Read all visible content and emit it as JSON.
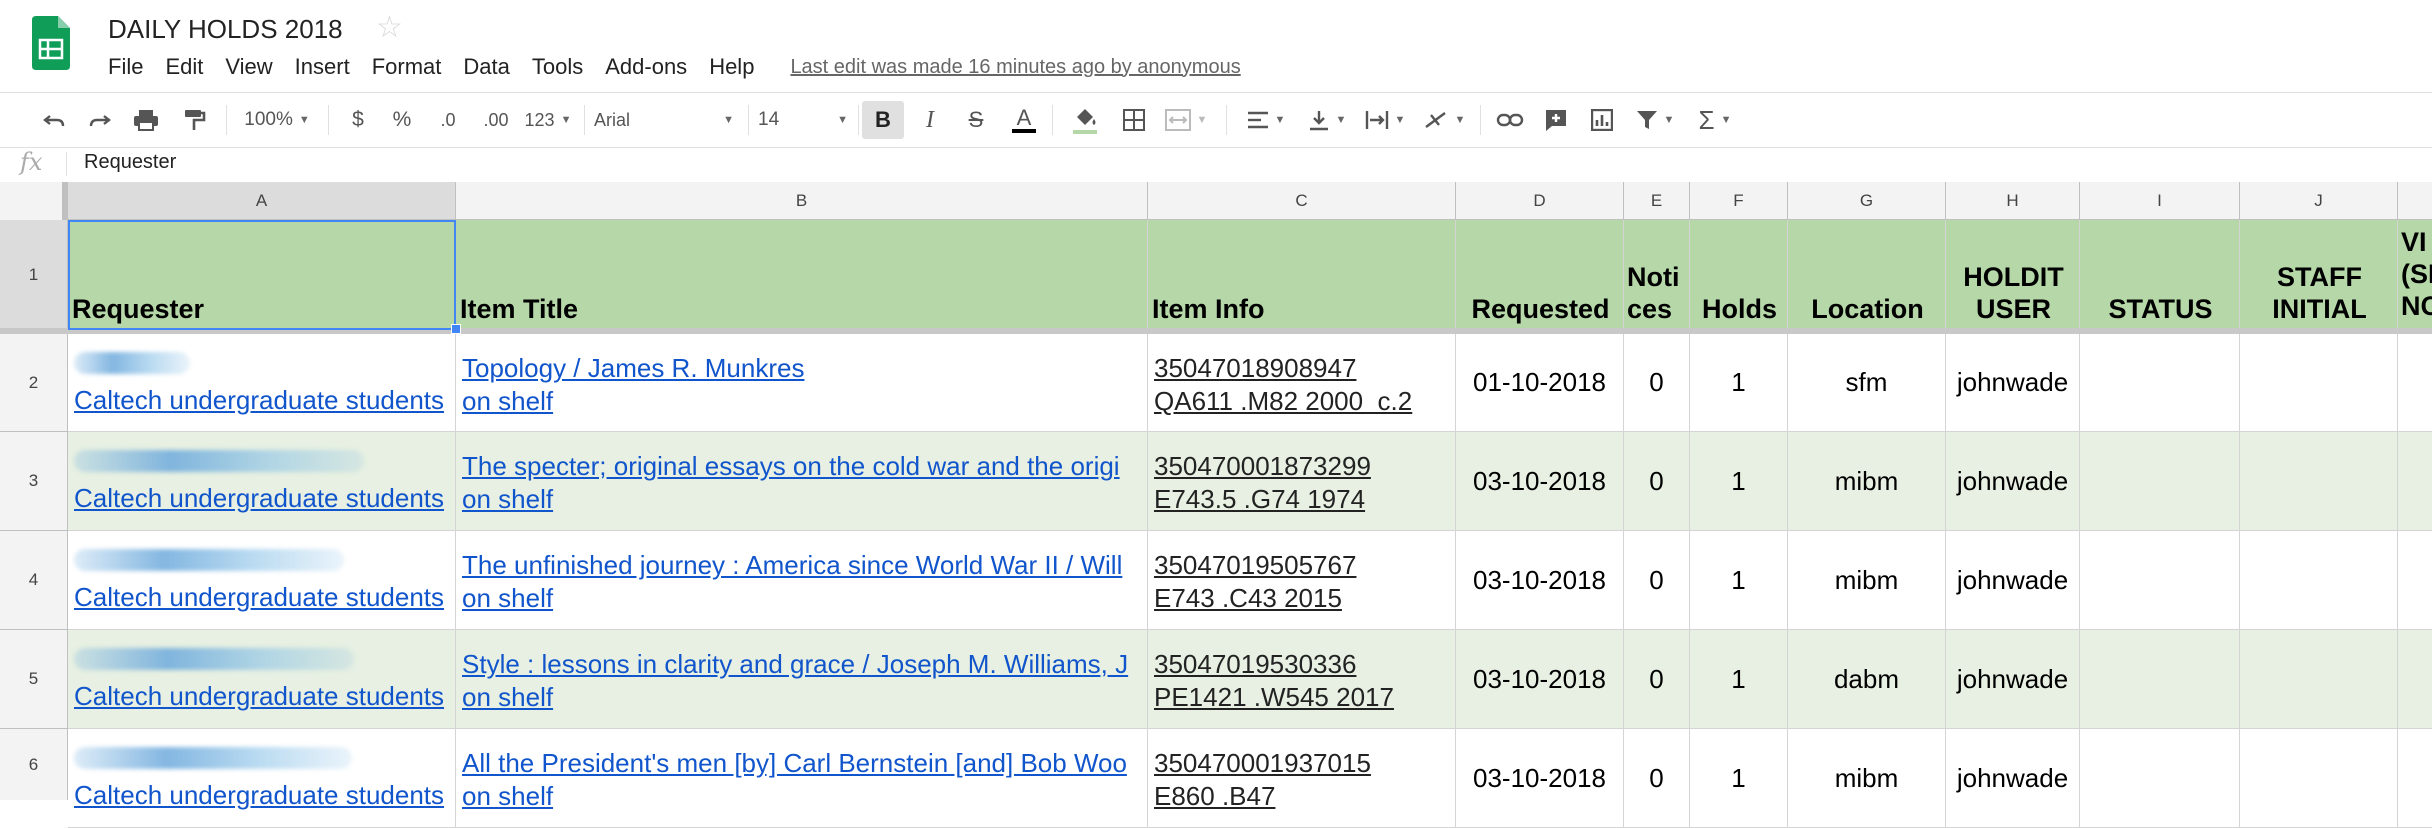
{
  "app": {
    "title": "DAILY HOLDS 2018",
    "last_edit": "Last edit was made 16 minutes ago by anonymous",
    "menus": [
      "File",
      "Edit",
      "View",
      "Insert",
      "Format",
      "Data",
      "Tools",
      "Add-ons",
      "Help"
    ]
  },
  "toolbar": {
    "zoom": "100%",
    "currency": "$",
    "percent": "%",
    "dec_less": ".0",
    "dec_more": ".00",
    "more_formats": "123",
    "font": "Arial",
    "font_size": "14",
    "bold": "B",
    "italic": "I",
    "strike": "S",
    "text_color": "A"
  },
  "formula_bar": {
    "fx": "fx",
    "value": "Requester"
  },
  "columns": [
    "A",
    "B",
    "C",
    "D",
    "E",
    "F",
    "G",
    "H",
    "I",
    "J"
  ],
  "row_numbers": [
    "1",
    "2",
    "3",
    "4",
    "5",
    "6"
  ],
  "headers": {
    "requester": "Requester",
    "item_title": "Item Title",
    "item_info": "Item Info",
    "requested": "Requested",
    "notices": "Noti ces",
    "holds": "Holds",
    "location": "Location",
    "holdit_user": "HOLDIT USER",
    "status": "STATUS",
    "staff_initial": "STAFF INITIAL",
    "overflow": "VI (SI NC"
  },
  "rows": [
    {
      "requester": "Caltech undergraduate students",
      "title": "Topology / James R. Munkres",
      "title_sub": "on shelf",
      "barcode": "35047018908947",
      "callno": "QA611 .M82 2000  c.2",
      "requested": "01-10-2018",
      "notices": "0",
      "holds": "1",
      "location": "sfm",
      "user": "johnwade"
    },
    {
      "requester": "Caltech undergraduate students",
      "title": "The specter; original essays on the cold war and the origi",
      "title_sub": "on shelf",
      "barcode": "350470001873299",
      "callno": "E743.5 .G74 1974",
      "requested": "03-10-2018",
      "notices": "0",
      "holds": "1",
      "location": "mibm",
      "user": "johnwade"
    },
    {
      "requester": "Caltech undergraduate students",
      "title": "The unfinished journey : America since World War II / Will",
      "title_sub": "on shelf",
      "barcode": "35047019505767",
      "callno": "E743 .C43 2015",
      "requested": "03-10-2018",
      "notices": "0",
      "holds": "1",
      "location": "mibm",
      "user": "johnwade"
    },
    {
      "requester": "Caltech undergraduate students",
      "title": "Style : lessons in clarity and grace / Joseph M. Williams, J",
      "title_sub": "on shelf",
      "barcode": "35047019530336",
      "callno": "PE1421 .W545 2017",
      "requested": "03-10-2018",
      "notices": "0",
      "holds": "1",
      "location": "dabm",
      "user": "johnwade"
    },
    {
      "requester": "Caltech undergraduate students",
      "title": "All the President's men [by] Carl Bernstein [and] Bob Woo",
      "title_sub": "on shelf",
      "barcode": "350470001937015",
      "callno": "E860 .B47",
      "requested": "03-10-2018",
      "notices": "0",
      "holds": "1",
      "location": "mibm",
      "user": "johnwade"
    }
  ],
  "colors": {
    "header_fill": "#b6d7a8",
    "band_fill": "#e7f0e2",
    "link": "#1155cc",
    "selection": "#4285f4",
    "sheets_green": "#0f9d58"
  }
}
